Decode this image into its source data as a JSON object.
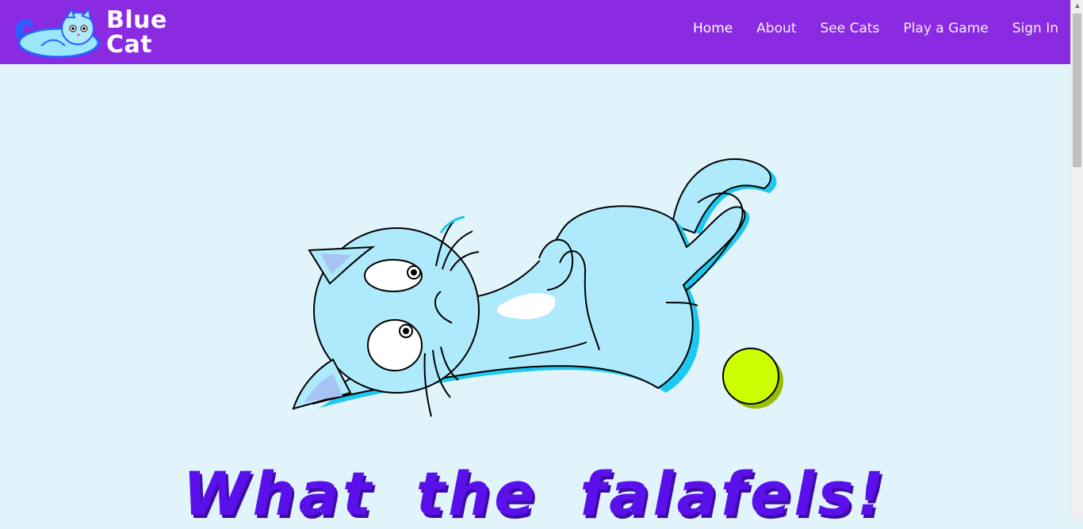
{
  "header": {
    "brand": {
      "line1": "Blue",
      "line2": "Cat",
      "logo_icon": "blue-cat-logo-icon"
    },
    "nav": [
      {
        "label": "Home",
        "active": true
      },
      {
        "label": "About"
      },
      {
        "label": "See Cats"
      },
      {
        "label": "Play a Game"
      },
      {
        "label": "Sign In"
      }
    ]
  },
  "hero": {
    "illustration": "lying-blue-cat-with-yellow-ball-illustration",
    "title": "What the falafels!"
  },
  "colors": {
    "navbar": "#8a2be2",
    "page_background": "#e1f3fb",
    "cat_fill": "#aeeafb",
    "cat_shadow": "#1ec8f0",
    "ball": "#ccff00",
    "title": "#5a10ea"
  }
}
